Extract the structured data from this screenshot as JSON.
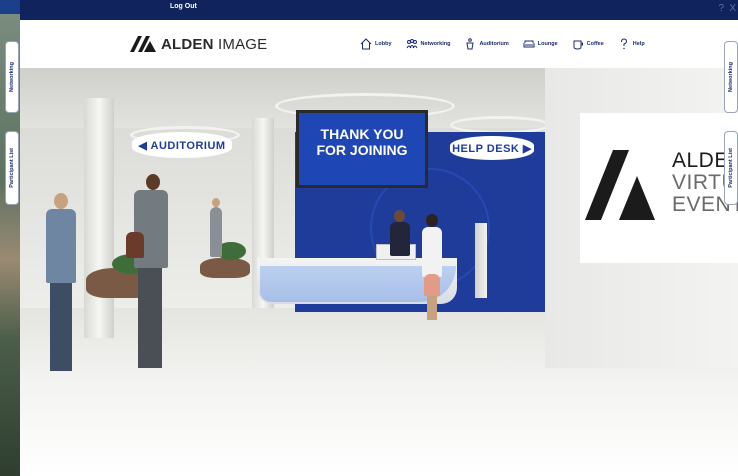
{
  "topbar": {
    "logout_label": "Log Out",
    "help_glyph": "?",
    "close_glyph": "X"
  },
  "header": {
    "logo": {
      "text_bold": "ALDEN",
      "text_light": " IMAGE",
      "icon": "alden-logo-mark"
    },
    "nav": [
      {
        "label": "Lobby",
        "icon": "house-icon"
      },
      {
        "label": "Networking",
        "icon": "people-icon"
      },
      {
        "label": "Auditorium",
        "icon": "podium-icon"
      },
      {
        "label": "Lounge",
        "icon": "sofa-icon"
      },
      {
        "label": "Coffee",
        "icon": "coffee-icon"
      },
      {
        "label": "Help",
        "icon": "question-icon"
      }
    ]
  },
  "side_tabs": {
    "left": [
      {
        "label": "Networking"
      },
      {
        "label": "Participant List"
      }
    ],
    "right": [
      {
        "label": "Networking"
      },
      {
        "label": "Participant List"
      }
    ]
  },
  "scene": {
    "tv_line1": "THANK YOU",
    "tv_line2": "FOR JOINING",
    "sign_auditorium": "◀ AUDITORIUM",
    "sign_helpdesk": "HELP DESK ▶",
    "wall_sign": {
      "line1": "ALDE",
      "line2": "VIRTU",
      "line3": "EVENT"
    }
  },
  "colors": {
    "navy": "#10235c",
    "brand_blue": "#1f3c9b",
    "screen_blue": "#1f46b5",
    "nav_text": "#1a2b6d"
  }
}
